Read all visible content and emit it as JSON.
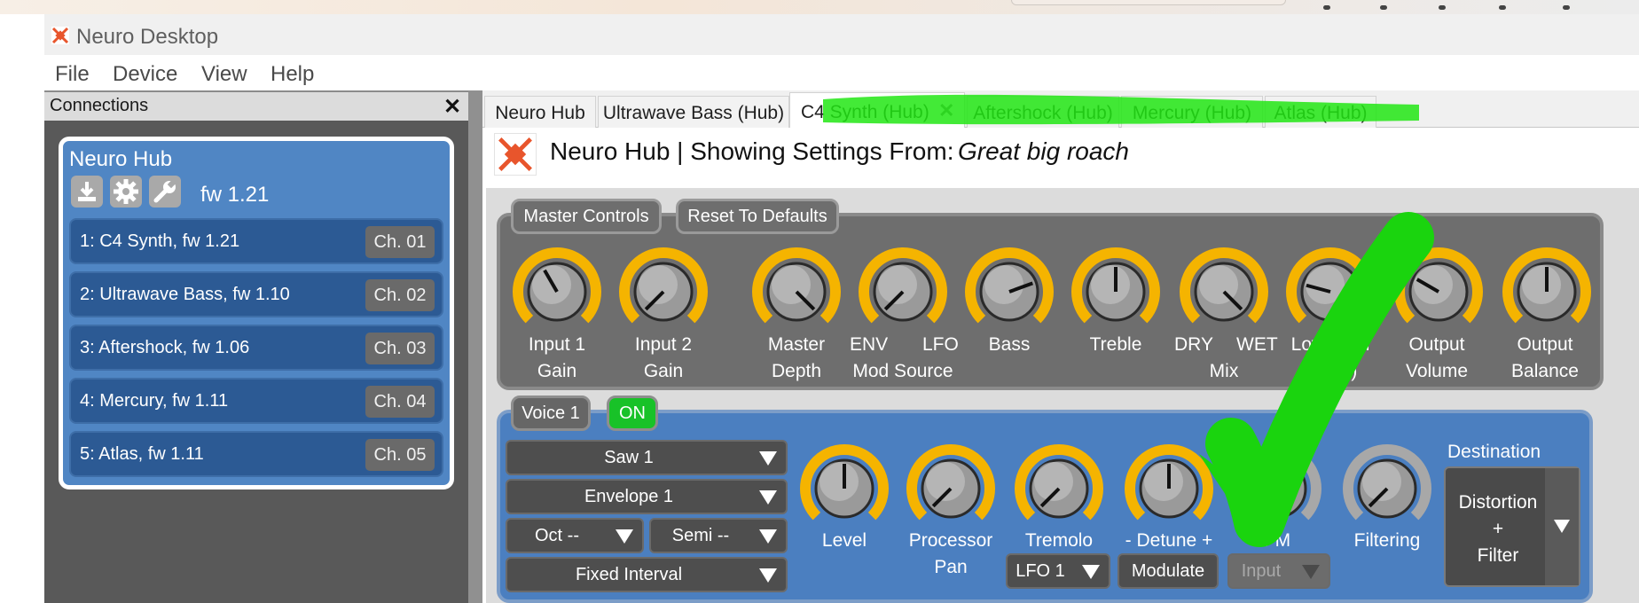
{
  "window": {
    "title": "Neuro Desktop"
  },
  "menu": [
    "File",
    "Device",
    "View",
    "Help"
  ],
  "connections": {
    "title": "Connections",
    "close": "✕",
    "hub": {
      "name": "Neuro Hub",
      "firmware": "fw 1.21",
      "devices": [
        {
          "label": "1: C4 Synth, fw 1.21",
          "channel": "Ch. 01"
        },
        {
          "label": "2: Ultrawave Bass, fw 1.10",
          "channel": "Ch. 02"
        },
        {
          "label": "3: Aftershock, fw 1.06",
          "channel": "Ch. 03"
        },
        {
          "label": "4: Mercury, fw 1.11",
          "channel": "Ch. 04"
        },
        {
          "label": "5: Atlas, fw 1.11",
          "channel": "Ch. 05"
        }
      ]
    }
  },
  "tabs": [
    {
      "label": "Neuro Hub"
    },
    {
      "label": "Ultrawave Bass (Hub)"
    },
    {
      "label": "C4 Synth (Hub)",
      "active": true,
      "close": "✕"
    },
    {
      "label": "Aftershock (Hub)"
    },
    {
      "label": "Mercury (Hub)"
    },
    {
      "label": "Atlas (Hub)"
    }
  ],
  "settings": {
    "title": "Neuro Hub | Showing Settings From:",
    "preset": "Great big roach"
  },
  "master": {
    "buttons": {
      "master_controls": "Master Controls",
      "reset": "Reset To Defaults"
    },
    "knobs": [
      {
        "l1": "Input 1",
        "l2": "Gain"
      },
      {
        "l1": "Input 2",
        "l2": "Gain"
      },
      {
        "l1": "Master",
        "l2": "Depth"
      },
      {
        "l1": "",
        "l2": "Mod Source",
        "left": "ENV",
        "right": "LFO"
      },
      {
        "l1": "Bass",
        "l2": ""
      },
      {
        "l1": "Treble",
        "l2": ""
      },
      {
        "l1": "",
        "l2": "Mix",
        "left": "DRY",
        "right": "WET"
      },
      {
        "l1": "Low Gain",
        "l2": "(WET)"
      },
      {
        "l1": "Output",
        "l2": "Volume"
      },
      {
        "l1": "Output",
        "l2": "Balance"
      }
    ]
  },
  "voice": {
    "name": "Voice 1",
    "on_label": "ON",
    "dropdowns": {
      "waveform": "Saw 1",
      "envelope": "Envelope 1",
      "oct": "Oct --",
      "semi": "Semi --",
      "interval": "Fixed Interval"
    },
    "knobs": [
      {
        "l1": "Level",
        "l2": ""
      },
      {
        "l1": "Processor",
        "l2": "Pan"
      },
      {
        "l1": "Tremolo",
        "l2": ""
      },
      {
        "l1": "- Detune +",
        "l2": ""
      },
      {
        "l1": "FM",
        "l2": ""
      },
      {
        "l1": "Filtering",
        "l2": ""
      }
    ],
    "lfo": "LFO 1",
    "modulate": "Modulate",
    "input": "Input",
    "destination_label": "Destination",
    "destination": {
      "line1": "Distortion",
      "line2": "+",
      "line3": "Filter"
    }
  },
  "colors": {
    "knob_ring": "#f5b400",
    "knob_ring_off": "#a8a8a8",
    "voice_panel": "#4b7fc0",
    "master_panel": "#6e6e6e",
    "on_green": "#18c228",
    "highlighter": "#22e614",
    "checkmark": "#1ad40e"
  }
}
